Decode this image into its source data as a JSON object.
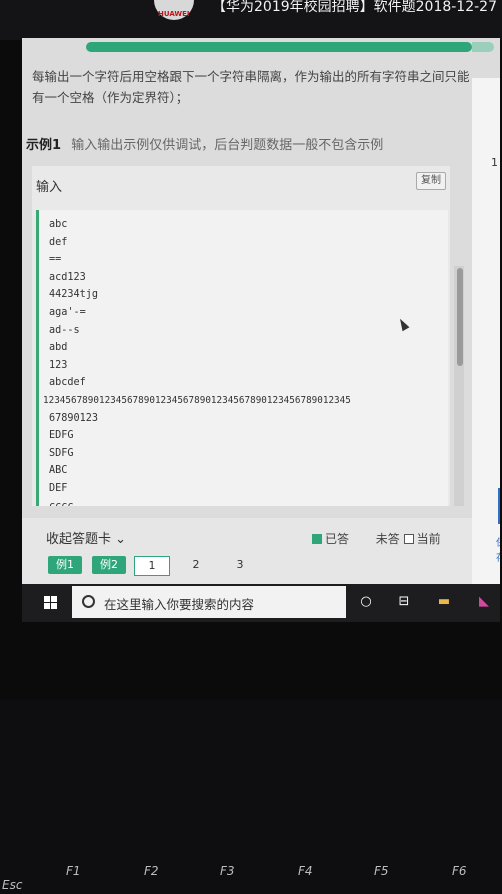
{
  "header": {
    "brand": "HUAWEI",
    "title": "【华为2019年校园招聘】软件题2018-12-27"
  },
  "problem": {
    "description": "每输出一个字符后用空格跟下一个字符串隔离，作为输出的所有字符串之间只能有一个空格（作为定界符）；"
  },
  "example": {
    "title": "示例1",
    "note": "输入输出示例仅供调试，后台判题数据一般不包含示例",
    "input_label": "输入",
    "copy_label": "复制",
    "lines": [
      "abc",
      "def",
      "==",
      "acd123",
      "44234tjg",
      "aga'-=",
      "ad--s",
      "abd",
      "123",
      "abcdef",
      "1234567890123456789012345678901234567890123456789012345",
      "67890123",
      "EDFG",
      "SDFG",
      "ABC",
      "DEF",
      "cccc"
    ]
  },
  "answer_card": {
    "collapse_label": "收起答题卡",
    "legend": {
      "answered": "已答",
      "unanswered": "未答",
      "current": "当前"
    },
    "buttons": [
      "例1",
      "例2",
      "1",
      "2",
      "3"
    ]
  },
  "taskbar": {
    "search_placeholder": "在这里输入你要搜索的内容"
  },
  "sidebar": {
    "line_number": "1",
    "save_label": "保存"
  },
  "keyboard": {
    "keys": [
      "Esc",
      "F1",
      "F2",
      "F3",
      "F4",
      "F5",
      "F6"
    ]
  }
}
